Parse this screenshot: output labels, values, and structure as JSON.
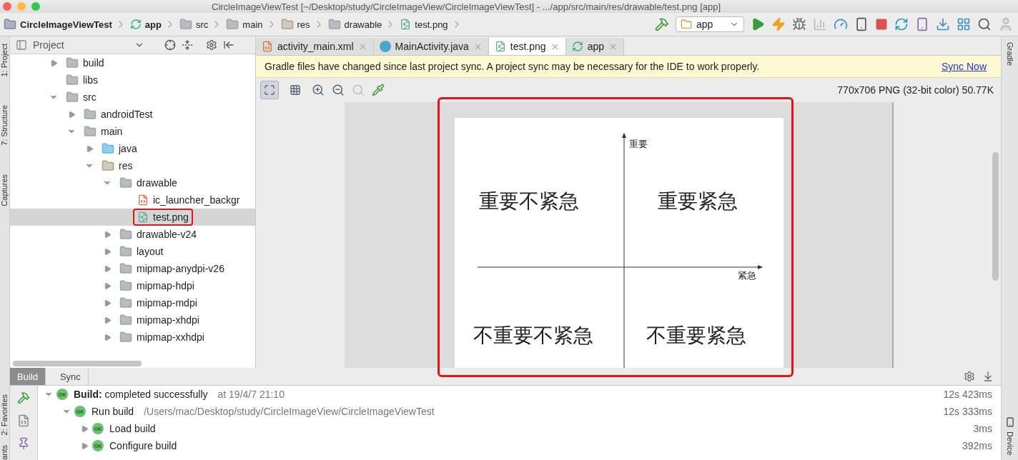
{
  "window": {
    "title": "CircleImageViewTest [~/Desktop/study/CircleImageView/CircleImageViewTest] - .../app/src/main/res/drawable/test.png [app]"
  },
  "breadcrumbs": [
    {
      "label": "CircleImageViewTest",
      "kind": "project",
      "bold": true
    },
    {
      "label": "app",
      "kind": "module",
      "bold": true
    },
    {
      "label": "src",
      "kind": "folder",
      "bold": false
    },
    {
      "label": "main",
      "kind": "folder",
      "bold": false
    },
    {
      "label": "res",
      "kind": "res-folder",
      "bold": false
    },
    {
      "label": "drawable",
      "kind": "folder",
      "bold": false
    },
    {
      "label": "test.png",
      "kind": "image-file",
      "bold": false
    }
  ],
  "run_config": {
    "value": "app"
  },
  "left_strip": [
    "1: Project",
    "7: Structure",
    "Captures",
    "2: Favorites",
    "ants"
  ],
  "right_strip": [
    "Gradle",
    "Device"
  ],
  "project_panel": {
    "title": "Project",
    "tree": [
      {
        "label": "build",
        "kind": "folder",
        "expanded": false,
        "selected": false,
        "highlighted": false
      },
      {
        "label": "libs",
        "kind": "folder",
        "selected": false,
        "highlighted": false
      },
      {
        "label": "src",
        "kind": "folder",
        "expanded": true,
        "selected": false,
        "highlighted": false,
        "children": [
          {
            "label": "androidTest",
            "kind": "folder",
            "expanded": false,
            "selected": false,
            "highlighted": false
          },
          {
            "label": "main",
            "kind": "folder",
            "expanded": true,
            "selected": false,
            "highlighted": false,
            "children": [
              {
                "label": "java",
                "kind": "source-folder",
                "expanded": false,
                "selected": false,
                "highlighted": false
              },
              {
                "label": "res",
                "kind": "res-folder",
                "expanded": true,
                "selected": false,
                "highlighted": false,
                "children": [
                  {
                    "label": "drawable",
                    "kind": "folder",
                    "expanded": true,
                    "selected": false,
                    "highlighted": false,
                    "children": [
                      {
                        "label": "ic_launcher_backgr",
                        "kind": "xml-file",
                        "selected": false,
                        "highlighted": false
                      },
                      {
                        "label": "test.png",
                        "kind": "image-file",
                        "selected": true,
                        "highlighted": true
                      }
                    ]
                  },
                  {
                    "label": "drawable-v24",
                    "kind": "folder",
                    "expanded": false,
                    "selected": false,
                    "highlighted": false
                  },
                  {
                    "label": "layout",
                    "kind": "folder",
                    "expanded": false,
                    "selected": false,
                    "highlighted": false
                  },
                  {
                    "label": "mipmap-anydpi-v26",
                    "kind": "folder",
                    "expanded": false,
                    "selected": false,
                    "highlighted": false
                  },
                  {
                    "label": "mipmap-hdpi",
                    "kind": "folder",
                    "expanded": false,
                    "selected": false,
                    "highlighted": false
                  },
                  {
                    "label": "mipmap-mdpi",
                    "kind": "folder",
                    "expanded": false,
                    "selected": false,
                    "highlighted": false
                  },
                  {
                    "label": "mipmap-xhdpi",
                    "kind": "folder",
                    "expanded": false,
                    "selected": false,
                    "highlighted": false
                  },
                  {
                    "label": "mipmap-xxhdpi",
                    "kind": "folder",
                    "expanded": false,
                    "selected": false,
                    "highlighted": false
                  }
                ]
              }
            ]
          }
        ]
      }
    ]
  },
  "editor_tabs": [
    {
      "label": "activity_main.xml",
      "kind": "xml-file",
      "selected": false
    },
    {
      "label": "MainActivity.java",
      "kind": "class",
      "selected": false
    },
    {
      "label": "test.png",
      "kind": "image-file",
      "selected": true
    },
    {
      "label": "app",
      "kind": "module",
      "selected": false
    }
  ],
  "sync_banner": {
    "message": "Gradle files have changed since last project sync. A project sync may be necessary for the IDE to work properly.",
    "link": "Sync Now"
  },
  "image_info": "770x706 PNG (32-bit color) 50.77K",
  "image_preview": {
    "highlighted": true,
    "y_axis_label": "重要",
    "x_axis_label": "紧急",
    "quadrants": [
      "重要不紧急",
      "重要紧急",
      "不重要不紧急",
      "不重要紧急"
    ]
  },
  "build_panel": {
    "tabs": [
      {
        "label": "Build",
        "selected": true
      },
      {
        "label": "Sync",
        "selected": false
      }
    ],
    "rows": [
      {
        "label": "**Build:** completed successfully",
        "detail": "at 19/4/7 21:10",
        "time": "12s 423ms",
        "status": "OK",
        "expanded": true,
        "children": [
          {
            "label": "Run build",
            "detail": "/Users/mac/Desktop/study/CircleImageView/CircleImageViewTest",
            "time": "12s 333ms",
            "status": "OK",
            "expanded": true,
            "children": [
              {
                "label": "Load build",
                "time": "3ms",
                "status": "OK",
                "expanded": false
              },
              {
                "label": "Configure build",
                "time": "392ms",
                "status": "OK",
                "expanded": false
              }
            ]
          }
        ]
      }
    ]
  }
}
